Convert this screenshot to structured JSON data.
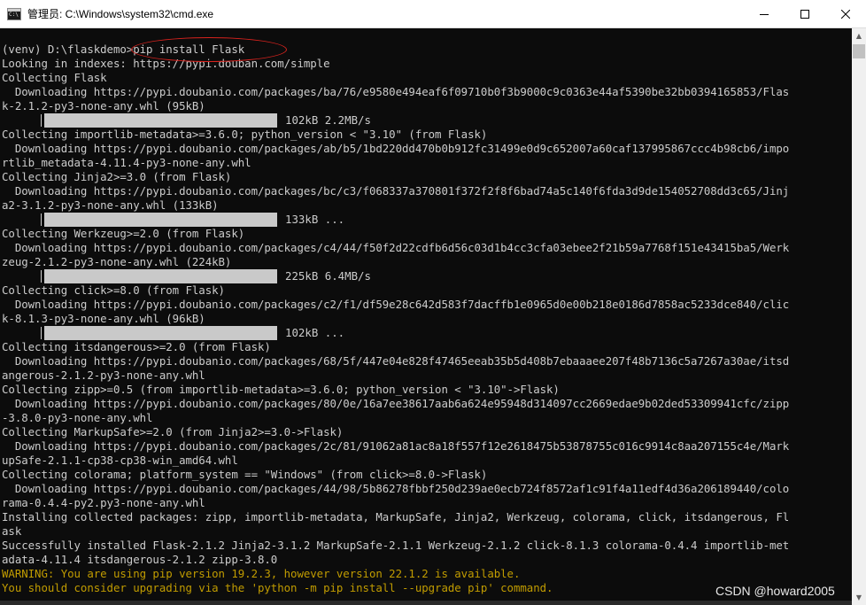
{
  "window": {
    "title": "管理员: C:\\Windows\\system32\\cmd.exe",
    "icon": "cmd-icon",
    "colors": {
      "terminal_bg": "#0c0c0c",
      "terminal_fg": "#cccccc",
      "warning_fg": "#c19c00",
      "progress_bar": "#c9c9c9",
      "annotation": "#d9231e"
    }
  },
  "terminal": {
    "lines": [
      {
        "text": "(venv) D:\\flaskdemo>pip install Flask",
        "type": "normal"
      },
      {
        "text": "Looking in indexes: https://pypi.douban.com/simple",
        "type": "normal"
      },
      {
        "text": "Collecting Flask",
        "type": "normal"
      },
      {
        "text": "  Downloading https://pypi.doubanio.com/packages/ba/76/e9580e494eaf6f09710b0f3b9000c9c0363e44af5390be32bb0394165853/Flas",
        "type": "normal"
      },
      {
        "text": "k-2.1.2-py3-none-any.whl (95kB)",
        "type": "normal"
      },
      {
        "text": "",
        "type": "progress",
        "progress": "102kB 2.2MB/s"
      },
      {
        "text": "Collecting importlib-metadata>=3.6.0; python_version < \"3.10\" (from Flask)",
        "type": "normal"
      },
      {
        "text": "  Downloading https://pypi.doubanio.com/packages/ab/b5/1bd220dd470b0b912fc31499e0d9c652007a60caf137995867ccc4b98cb6/impo",
        "type": "normal"
      },
      {
        "text": "rtlib_metadata-4.11.4-py3-none-any.whl",
        "type": "normal"
      },
      {
        "text": "Collecting Jinja2>=3.0 (from Flask)",
        "type": "normal"
      },
      {
        "text": "  Downloading https://pypi.doubanio.com/packages/bc/c3/f068337a370801f372f2f8f6bad74a5c140f6fda3d9de154052708dd3c65/Jinj",
        "type": "normal"
      },
      {
        "text": "a2-3.1.2-py3-none-any.whl (133kB)",
        "type": "normal"
      },
      {
        "text": "",
        "type": "progress",
        "progress": "133kB ..."
      },
      {
        "text": "Collecting Werkzeug>=2.0 (from Flask)",
        "type": "normal"
      },
      {
        "text": "  Downloading https://pypi.doubanio.com/packages/c4/44/f50f2d22cdfb6d56c03d1b4cc3cfa03ebee2f21b59a7768f151e43415ba5/Werk",
        "type": "normal"
      },
      {
        "text": "zeug-2.1.2-py3-none-any.whl (224kB)",
        "type": "normal"
      },
      {
        "text": "",
        "type": "progress",
        "progress": "225kB 6.4MB/s"
      },
      {
        "text": "Collecting click>=8.0 (from Flask)",
        "type": "normal"
      },
      {
        "text": "  Downloading https://pypi.doubanio.com/packages/c2/f1/df59e28c642d583f7dacffb1e0965d0e00b218e0186d7858ac5233dce840/clic",
        "type": "normal"
      },
      {
        "text": "k-8.1.3-py3-none-any.whl (96kB)",
        "type": "normal"
      },
      {
        "text": "",
        "type": "progress",
        "progress": "102kB ..."
      },
      {
        "text": "Collecting itsdangerous>=2.0 (from Flask)",
        "type": "normal"
      },
      {
        "text": "  Downloading https://pypi.doubanio.com/packages/68/5f/447e04e828f47465eeab35b5d408b7ebaaaee207f48b7136c5a7267a30ae/itsd",
        "type": "normal"
      },
      {
        "text": "angerous-2.1.2-py3-none-any.whl",
        "type": "normal"
      },
      {
        "text": "Collecting zipp>=0.5 (from importlib-metadata>=3.6.0; python_version < \"3.10\"->Flask)",
        "type": "normal"
      },
      {
        "text": "  Downloading https://pypi.doubanio.com/packages/80/0e/16a7ee38617aab6a624e95948d314097cc2669edae9b02ded53309941cfc/zipp",
        "type": "normal"
      },
      {
        "text": "-3.8.0-py3-none-any.whl",
        "type": "normal"
      },
      {
        "text": "Collecting MarkupSafe>=2.0 (from Jinja2>=3.0->Flask)",
        "type": "normal"
      },
      {
        "text": "  Downloading https://pypi.doubanio.com/packages/2c/81/91062a81ac8a18f557f12e2618475b53878755c016c9914c8aa207155c4e/Mark",
        "type": "normal"
      },
      {
        "text": "upSafe-2.1.1-cp38-cp38-win_amd64.whl",
        "type": "normal"
      },
      {
        "text": "Collecting colorama; platform_system == \"Windows\" (from click>=8.0->Flask)",
        "type": "normal"
      },
      {
        "text": "  Downloading https://pypi.doubanio.com/packages/44/98/5b86278fbbf250d239ae0ecb724f8572af1c91f4a11edf4d36a206189440/colo",
        "type": "normal"
      },
      {
        "text": "rama-0.4.4-py2.py3-none-any.whl",
        "type": "normal"
      },
      {
        "text": "Installing collected packages: zipp, importlib-metadata, MarkupSafe, Jinja2, Werkzeug, colorama, click, itsdangerous, Fl",
        "type": "normal"
      },
      {
        "text": "ask",
        "type": "normal"
      },
      {
        "text": "Successfully installed Flask-2.1.2 Jinja2-3.1.2 MarkupSafe-2.1.1 Werkzeug-2.1.2 click-8.1.3 colorama-0.4.4 importlib-met",
        "type": "normal"
      },
      {
        "text": "adata-4.11.4 itsdangerous-2.1.2 zipp-3.8.0",
        "type": "normal"
      },
      {
        "text": "WARNING: You are using pip version 19.2.3, however version 22.1.2 is available.",
        "type": "warn"
      },
      {
        "text": "You should consider upgrading via the 'python -m pip install --upgrade pip' command.",
        "type": "warn"
      }
    ]
  },
  "watermark": "CSDN @howard2005",
  "scrollbar": {
    "up_icon": "scroll-up-arrow-icon",
    "down_icon": "scroll-down-arrow-icon"
  }
}
